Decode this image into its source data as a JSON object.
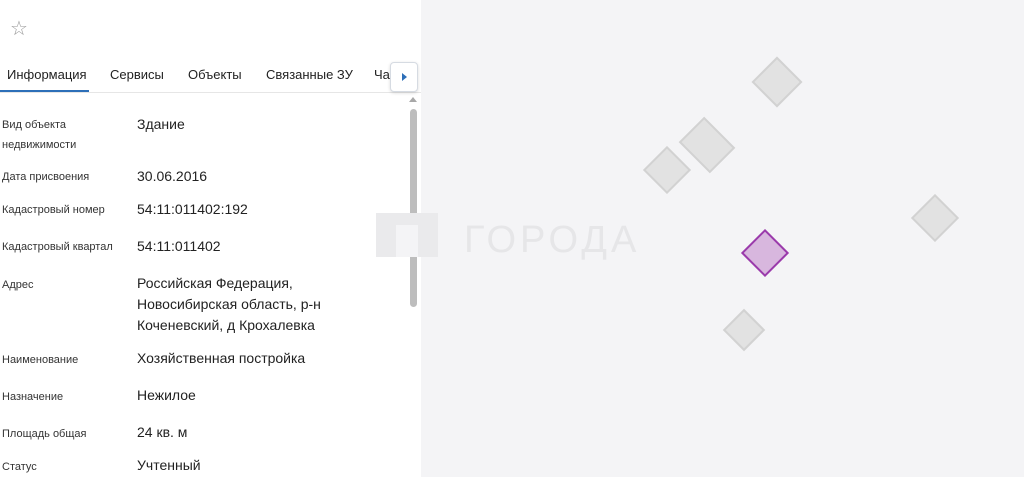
{
  "tabs": {
    "items": [
      "Информация",
      "Сервисы",
      "Объекты",
      "Связанные ЗУ"
    ],
    "clipped": "Части ЗУ"
  },
  "properties": [
    {
      "label": "Вид объекта недвижимости",
      "value": "Здание"
    },
    {
      "label": "Дата присвоения",
      "value": "30.06.2016"
    },
    {
      "label": "Кадастровый номер",
      "value": "54:11:011402:192"
    },
    {
      "label": "Кадастровый квартал",
      "value": "54:11:011402"
    },
    {
      "label": "Адрес",
      "value": "Российская Федерация, Новосибирская область, р-н Коченевский, д Крохалевка"
    },
    {
      "label": "Наименование",
      "value": "Хозяйственная постройка"
    },
    {
      "label": "Назначение",
      "value": "Нежилое"
    },
    {
      "label": "Площадь общая",
      "value": "24 кв. м"
    },
    {
      "label": "Статус",
      "value": "Учтенный"
    }
  ],
  "map": {
    "watermark": "ГОРОДА"
  },
  "icons": {
    "favorite": "star-outline-icon",
    "tabs_next": "triangle-right-icon"
  },
  "colors": {
    "accent": "#2d6fb8",
    "selected_fill": "#d8b7de",
    "selected_border": "#9a3aab",
    "building_fill": "#e2e2e2"
  }
}
